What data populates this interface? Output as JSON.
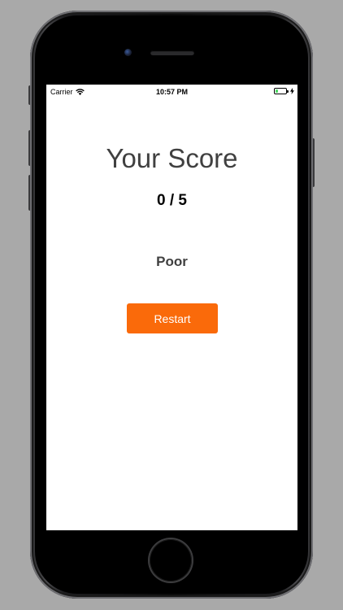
{
  "status_bar": {
    "carrier": "Carrier",
    "time": "10:57 PM",
    "battery_level": 0.25,
    "battery_color": "#4cd964",
    "wifi_icon": "wifi-icon",
    "charging_icon": "bolt-icon"
  },
  "results": {
    "title": "Your Score",
    "score": "0 / 5",
    "rating": "Poor"
  },
  "actions": {
    "restart_label": "Restart",
    "accent_color": "#fa6a0a"
  }
}
